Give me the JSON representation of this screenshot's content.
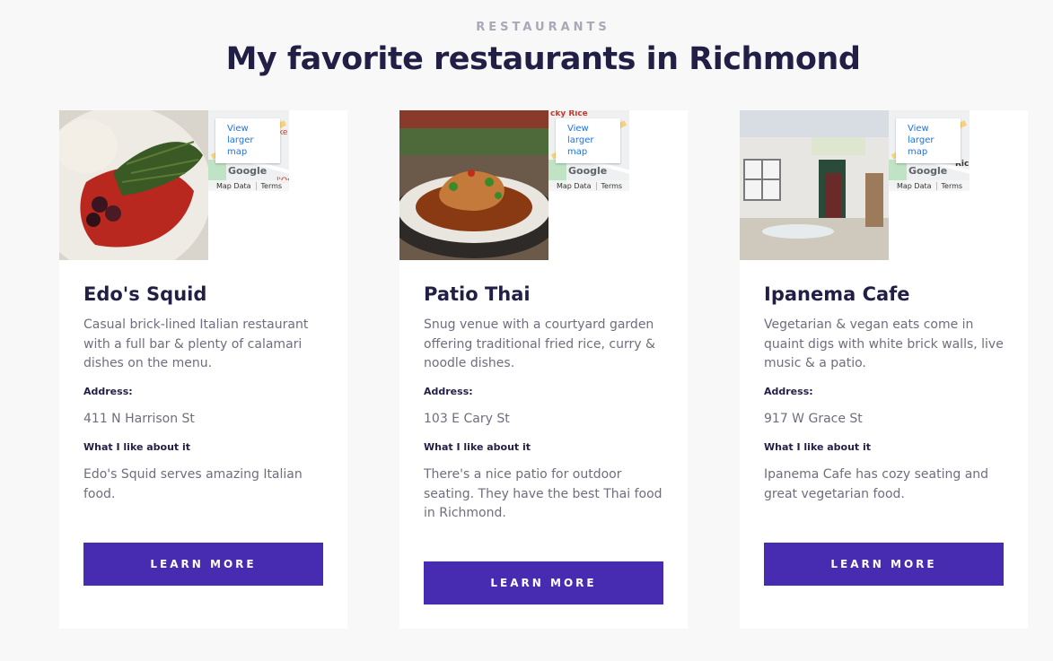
{
  "header": {
    "eyebrow": "RESTAURANTS",
    "title": "My favorite restaurants in Richmond"
  },
  "map_labels": {
    "view_link": "View larger map",
    "google": "Google",
    "map_data": "Map Data",
    "terms": "Terms"
  },
  "labels": {
    "address": "Address:",
    "like": "What I like about it",
    "button": "LEARN MORE"
  },
  "restaurants": [
    {
      "name": "Edo's Squid",
      "description": "Casual brick-lined Italian restaurant with a full bar & plenty of calamari dishes on the menu.",
      "address": "411 N Harrison St",
      "like": "Edo's Squid serves amazing Italian food."
    },
    {
      "name": "Patio Thai",
      "description": "Snug venue with a courtyard garden offering traditional fried rice, curry & noodle dishes.",
      "address": "103 E Cary St",
      "like": "There's a nice patio for outdoor seating. They have the best Thai food in Richmond."
    },
    {
      "name": "Ipanema Cafe",
      "description": "Vegetarian & vegan eats come in quaint digs with white brick walls, live music & a patio.",
      "address": "917 W Grace St",
      "like": "Ipanema Cafe has cozy seating and great vegetarian food."
    }
  ],
  "colors": {
    "accent": "#472cb2",
    "heading": "#221f46",
    "body_text": "#6e6e7e",
    "eyebrow": "#a8a9b6",
    "background": "#f8f8f9"
  }
}
